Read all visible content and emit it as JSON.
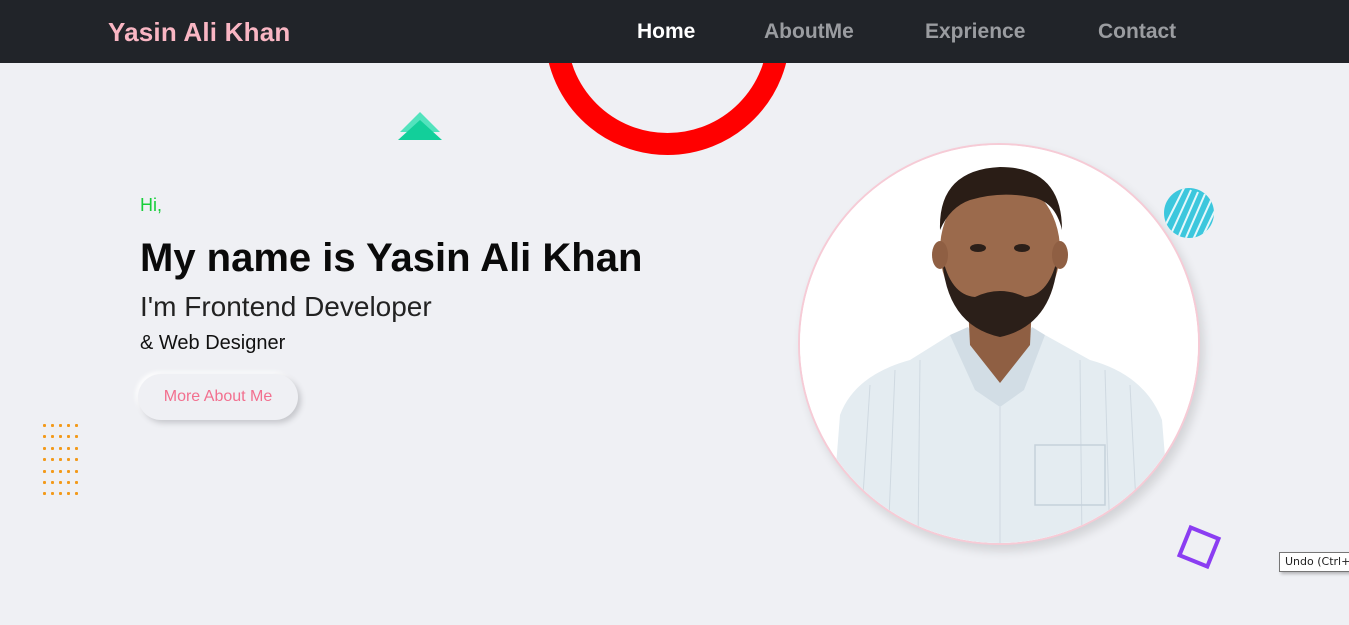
{
  "nav": {
    "brand": "Yasin Ali Khan",
    "links": [
      {
        "label": "Home",
        "active": true
      },
      {
        "label": "AboutMe",
        "active": false
      },
      {
        "label": "Exprience",
        "active": false
      },
      {
        "label": "Contact",
        "active": false
      }
    ]
  },
  "hero": {
    "greeting": "Hi,",
    "name": "My name is Yasin Ali Khan",
    "role": "I'm Frontend Developer",
    "role2": "& Web Designer",
    "button_label": "More About Me"
  },
  "tooltip": "Undo (Ctrl+Z)",
  "colors": {
    "nav_bg": "#212429",
    "brand": "#f9b6c3",
    "greeting": "#17cf3a",
    "button_text": "#f2708f",
    "ring": "#ff0000",
    "triangle": "#16d6a3",
    "hatch_circle": "#3cc7dd",
    "square": "#8b3df2",
    "dots": "#f39a1a"
  },
  "icons": [
    "triangle-shape",
    "red-ring-shape",
    "hatched-circle-shape",
    "dot-grid-shape",
    "rotated-square-shape",
    "profile-photo"
  ]
}
